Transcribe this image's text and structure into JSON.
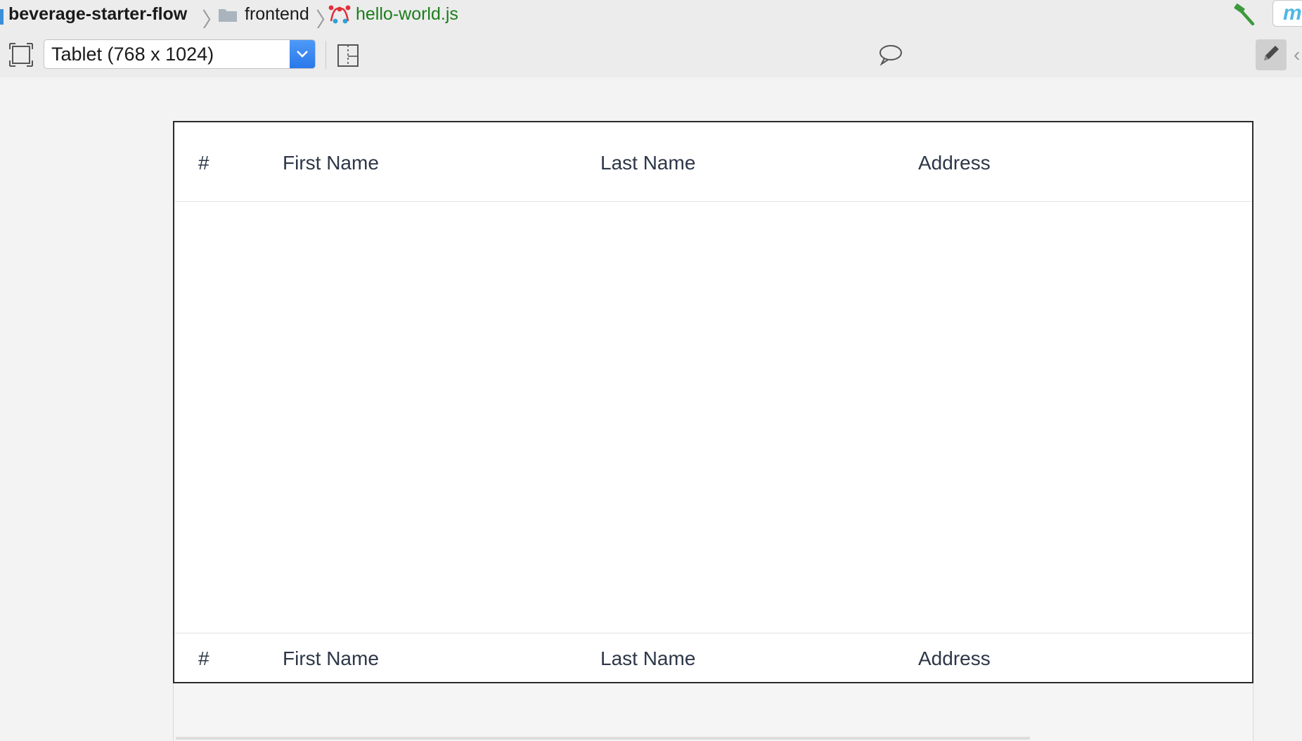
{
  "breadcrumb": {
    "project": "beverage-starter-flow",
    "folder": "frontend",
    "file": "hello-world.js"
  },
  "icons": {
    "folder": "folder-icon",
    "file": "js-file-icon",
    "build": "hammer-icon",
    "frame": "frame-icon",
    "rotate": "rotate-icon",
    "comment": "comment-icon",
    "edit": "pencil-icon"
  },
  "plugin_tab": {
    "label": "m"
  },
  "toolbar": {
    "device_selected": "Tablet (768 x 1024)",
    "right_chevron": "‹"
  },
  "table": {
    "header": [
      "#",
      "First Name",
      "Last Name",
      "Address"
    ],
    "footer": [
      "#",
      "First Name",
      "Last Name",
      "Address"
    ],
    "rows": []
  },
  "colors": {
    "accent": "#2a78ea",
    "file_link": "#1b7d1b",
    "table_text": "#2d3748",
    "plugin": "#4fb7e6"
  }
}
